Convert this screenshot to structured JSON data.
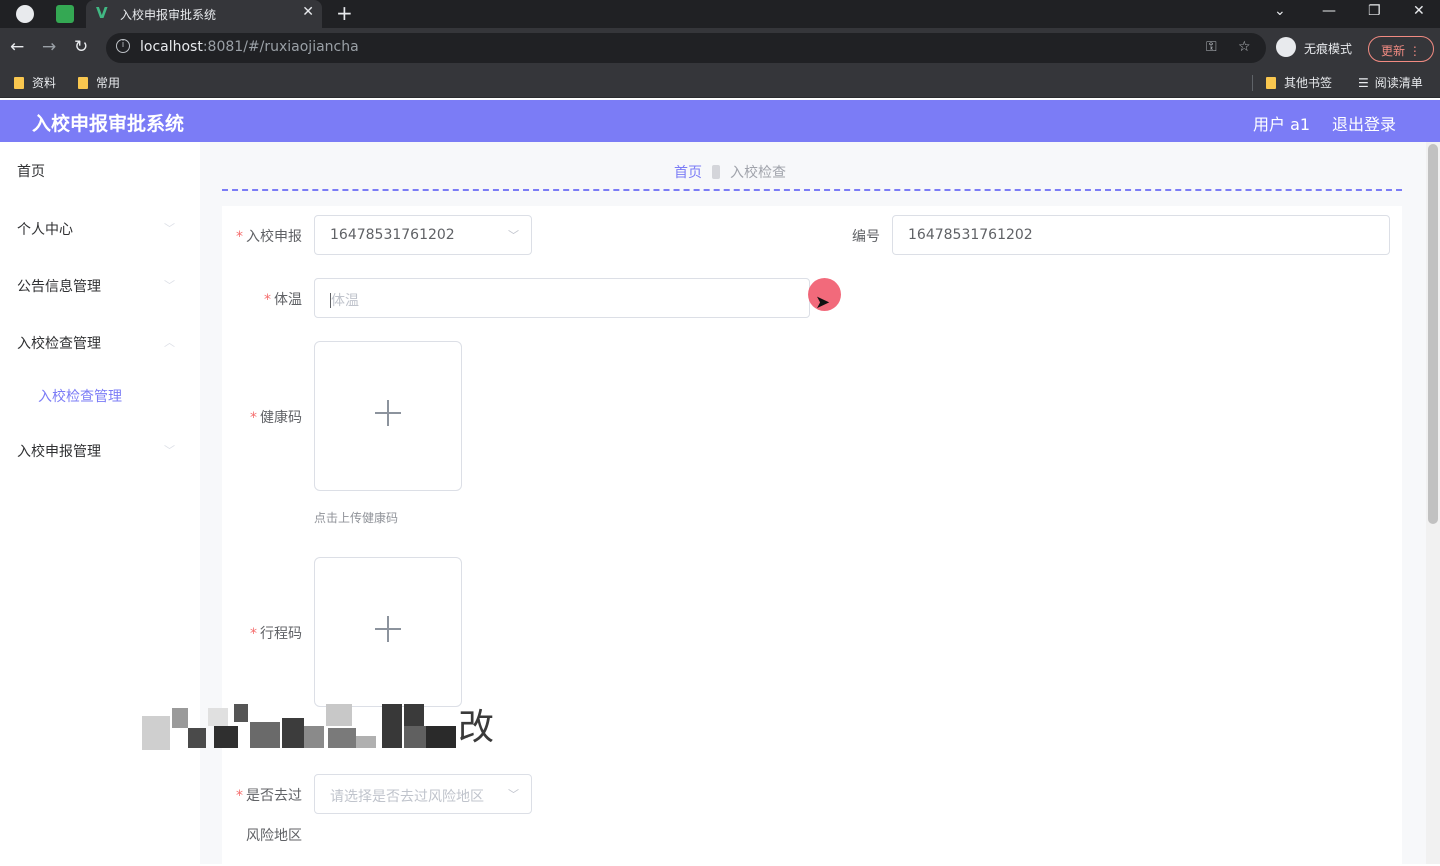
{
  "browser": {
    "tab_title": "入校申报审批系统",
    "url_host": "localhost",
    "url_rest": ":8081/#/ruxiaojiancha",
    "incognito_label": "无痕模式",
    "update_label": "更新",
    "bookmarks": [
      "资料",
      "常用"
    ],
    "bookmarks_right": [
      "其他书签",
      "阅读清单"
    ]
  },
  "header": {
    "title": "入校申报审批系统",
    "user": "用户 a1",
    "logout": "退出登录",
    "accent": "#7b7cf6"
  },
  "sidebar": {
    "items": [
      {
        "label": "首页"
      },
      {
        "label": "个人中心"
      },
      {
        "label": "公告信息管理"
      },
      {
        "label": "入校检查管理"
      },
      {
        "label": "入校申报管理"
      }
    ],
    "sub_items": [
      {
        "label": "入校检查管理"
      }
    ]
  },
  "breadcrumb": {
    "home": "首页",
    "current": "入校检查"
  },
  "form": {
    "apply_label": "入校申报",
    "apply_value": "16478531761202",
    "number_label": "编号",
    "number_value": "16478531761202",
    "temp_label": "体温",
    "temp_placeholder": "体温",
    "health_label": "健康码",
    "health_tip": "点击上传健康码",
    "trip_label": "行程码",
    "risk_label_line1": "是否去过",
    "risk_label_line2": "风险地区",
    "risk_placeholder": "请选择是否去过风险地区",
    "overlay_char": "改"
  }
}
